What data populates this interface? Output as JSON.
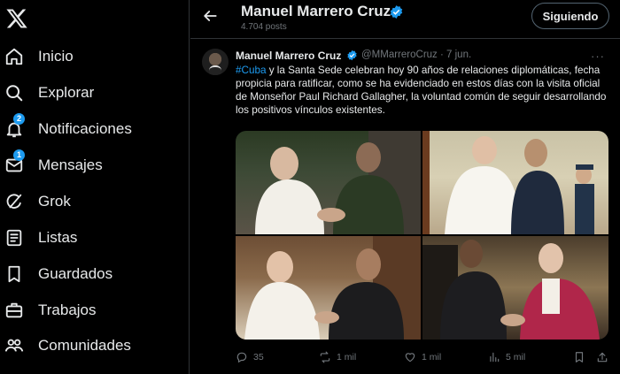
{
  "sidebar": {
    "logo_icon": "x-logo-icon",
    "items": [
      {
        "label": "Inicio",
        "icon": "home-icon"
      },
      {
        "label": "Explorar",
        "icon": "search-icon"
      },
      {
        "label": "Notificaciones",
        "icon": "bell-icon",
        "badge": "2"
      },
      {
        "label": "Mensajes",
        "icon": "envelope-icon",
        "badge": "1"
      },
      {
        "label": "Grok",
        "icon": "grok-icon"
      },
      {
        "label": "Listas",
        "icon": "list-icon"
      },
      {
        "label": "Guardados",
        "icon": "bookmark-icon"
      },
      {
        "label": "Trabajos",
        "icon": "briefcase-icon"
      },
      {
        "label": "Comunidades",
        "icon": "communities-icon"
      }
    ]
  },
  "header": {
    "name": "Manuel Marrero Cruz",
    "posts": "4.704 posts",
    "follow_label": "Siguiendo"
  },
  "tweet": {
    "name": "Manuel Marrero Cruz",
    "handle": "@MMarreroCruz",
    "date": "· 7 jun.",
    "more": "···",
    "hashtag": "#Cuba",
    "text": " y la Santa Sede celebran hoy 90 años de relaciones diplomáticas, fecha propicia para ratificar, como se ha evidenciado en estos días con la visita oficial de Monseñor Paul Richard Gallagher, la voluntad común de seguir desarrollando los positivos vínculos existentes.",
    "replies": "35",
    "reposts": "1 mil",
    "likes": "1 mil",
    "views": "5 mil"
  },
  "colors": {
    "accent": "#1d9bf0",
    "muted": "#71767b",
    "border": "#2f3336",
    "text": "#e7e9ea",
    "background": "#000000"
  }
}
